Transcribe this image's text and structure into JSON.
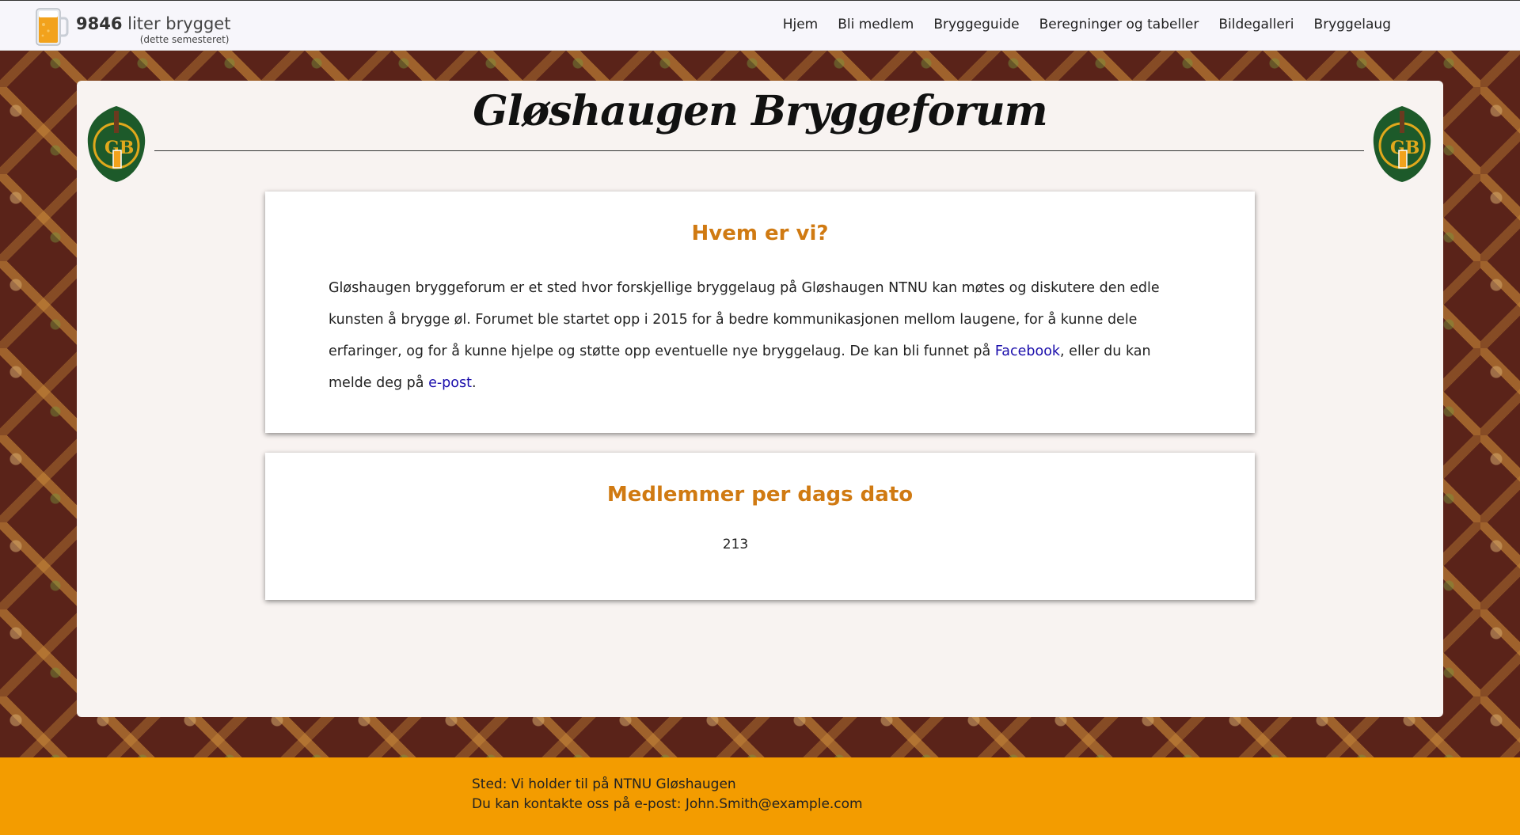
{
  "brand": {
    "count": "9846",
    "count_suffix": " liter brygget",
    "subtitle": "(dette semesteret)"
  },
  "nav": {
    "items": [
      {
        "label": "Hjem"
      },
      {
        "label": "Bli medlem"
      },
      {
        "label": "Bryggeguide"
      },
      {
        "label": "Beregninger og tabeller"
      },
      {
        "label": "Bildegalleri"
      },
      {
        "label": "Bryggelaug"
      }
    ]
  },
  "header": {
    "title": "Gløshaugen Bryggeforum",
    "crest_letters": "GB"
  },
  "about": {
    "heading": "Hvem er vi?",
    "text_1": "Gløshaugen bryggeforum er et sted hvor forskjellige bryggelaug på Gløshaugen NTNU kan møtes og diskutere den edle kunsten å brygge øl. Forumet ble startet opp i 2015 for å bedre kommunikasjonen mellom laugene, for å kunne dele erfaringer, og for å kunne hjelpe og støtte opp eventuelle nye bryggelaug. De kan bli funnet på ",
    "facebook_link": "Facebook",
    "text_2": ", eller du kan melde deg på ",
    "email_link": "e-post",
    "text_3": "."
  },
  "members": {
    "heading": "Medlemmer per dags dato",
    "count": "213"
  },
  "footer": {
    "location": "Sted: Vi holder til på NTNU Gløshaugen",
    "contact": "Du kan kontakte oss på e-post: John.Smith@example.com"
  },
  "colors": {
    "accent": "#d07a12",
    "footer_bg": "#f39c00",
    "background": "#5a2319",
    "link": "#1a0dab",
    "crest_green": "#1d5a2a",
    "crest_gold": "#e0a81c"
  },
  "icons": {
    "brand": "beer-mug-icon",
    "crest": "crest-logo-icon"
  }
}
